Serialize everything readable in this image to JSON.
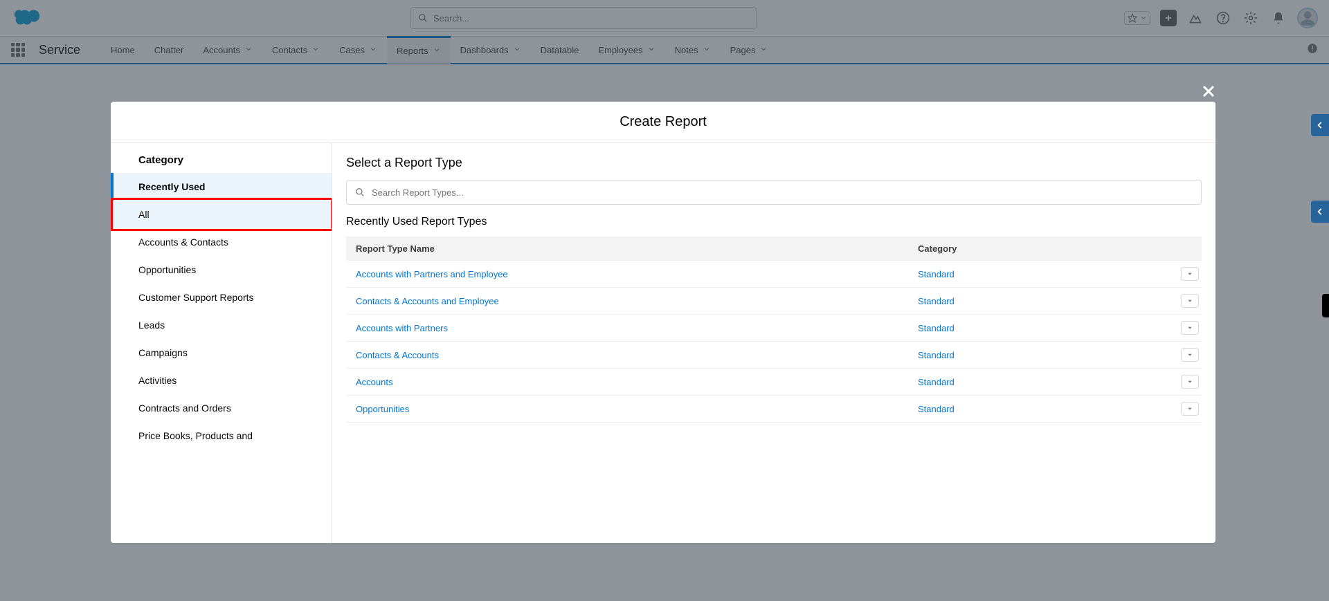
{
  "header": {
    "search_placeholder": "Search..."
  },
  "nav": {
    "app_name": "Service",
    "items": [
      {
        "label": "Home",
        "chevron": false
      },
      {
        "label": "Chatter",
        "chevron": false
      },
      {
        "label": "Accounts",
        "chevron": true
      },
      {
        "label": "Contacts",
        "chevron": true
      },
      {
        "label": "Cases",
        "chevron": true
      },
      {
        "label": "Reports",
        "chevron": true,
        "active": true
      },
      {
        "label": "Dashboards",
        "chevron": true
      },
      {
        "label": "Datatable",
        "chevron": false
      },
      {
        "label": "Employees",
        "chevron": true
      },
      {
        "label": "Notes",
        "chevron": true
      },
      {
        "label": "Pages",
        "chevron": true
      }
    ]
  },
  "modal": {
    "title": "Create Report",
    "sidebar_header": "Category",
    "categories": [
      {
        "label": "Recently Used",
        "selected": true
      },
      {
        "label": "All",
        "highlighted": true
      },
      {
        "label": "Accounts & Contacts"
      },
      {
        "label": "Opportunities"
      },
      {
        "label": "Customer Support Reports"
      },
      {
        "label": "Leads"
      },
      {
        "label": "Campaigns"
      },
      {
        "label": "Activities"
      },
      {
        "label": "Contracts and Orders"
      },
      {
        "label": "Price Books, Products and"
      }
    ],
    "main_title": "Select a Report Type",
    "search_placeholder": "Search Report Types...",
    "section_title": "Recently Used Report Types",
    "columns": {
      "name": "Report Type Name",
      "category": "Category"
    },
    "rows": [
      {
        "name": "Accounts with Partners and Employee",
        "category": "Standard"
      },
      {
        "name": "Contacts & Accounts and Employee",
        "category": "Standard"
      },
      {
        "name": "Accounts with Partners",
        "category": "Standard"
      },
      {
        "name": "Contacts & Accounts",
        "category": "Standard"
      },
      {
        "name": "Accounts",
        "category": "Standard"
      },
      {
        "name": "Opportunities",
        "category": "Standard"
      }
    ]
  }
}
